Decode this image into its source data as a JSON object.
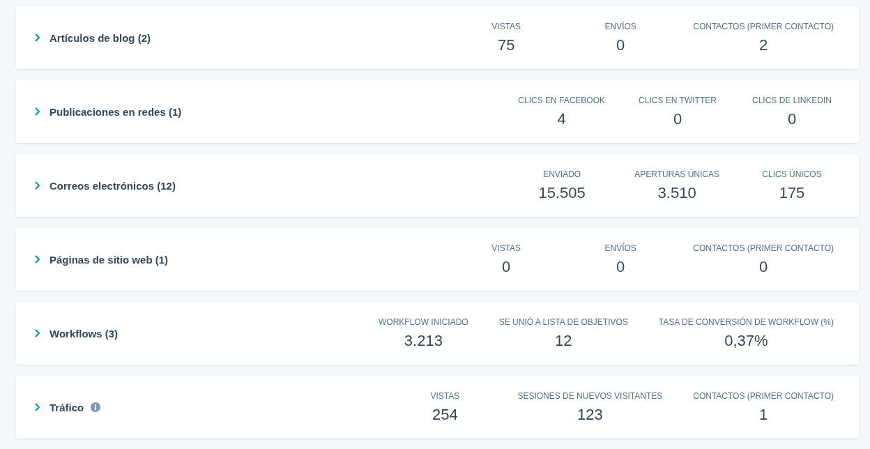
{
  "sections": [
    {
      "title": "Artículos de blog (2)",
      "expanded": false,
      "info": false,
      "metrics": [
        {
          "label": "VISTAS",
          "value": "75"
        },
        {
          "label": "ENVÍOS",
          "value": "0"
        },
        {
          "label": "CONTACTOS (PRIMER CONTACTO)",
          "value": "2"
        }
      ]
    },
    {
      "title": "Publicaciones en redes (1)",
      "expanded": false,
      "info": false,
      "metrics": [
        {
          "label": "CLICS EN FACEBOOK",
          "value": "4"
        },
        {
          "label": "CLICS EN TWITTER",
          "value": "0"
        },
        {
          "label": "CLICS DE LINKEDIN",
          "value": "0"
        }
      ]
    },
    {
      "title": "Correos electrónicos (12)",
      "expanded": false,
      "info": false,
      "metrics": [
        {
          "label": "ENVIADO",
          "value": "15.505"
        },
        {
          "label": "APERTURAS ÚNICAS",
          "value": "3.510"
        },
        {
          "label": "CLICS ÚNICOS",
          "value": "175"
        }
      ]
    },
    {
      "title": "Páginas de sitio web (1)",
      "expanded": false,
      "info": false,
      "metrics": [
        {
          "label": "VISTAS",
          "value": "0"
        },
        {
          "label": "ENVÍOS",
          "value": "0"
        },
        {
          "label": "CONTACTOS (PRIMER CONTACTO)",
          "value": "0"
        }
      ]
    },
    {
      "title": "Workflows (3)",
      "expanded": false,
      "info": false,
      "metrics": [
        {
          "label": "WORKFLOW INICIADO",
          "value": "3.213"
        },
        {
          "label": "SE UNIÓ A LISTA DE OBJETIVOS",
          "value": "12"
        },
        {
          "label": "TASA DE CONVERSIÓN DE WORKFLOW (%)",
          "value": "0,37%"
        }
      ]
    },
    {
      "title": "Tráfico",
      "expanded": false,
      "info": true,
      "metrics": [
        {
          "label": "VISTAS",
          "value": "254"
        },
        {
          "label": "SESIONES DE NUEVOS VISITANTES",
          "value": "123"
        },
        {
          "label": "CONTACTOS (PRIMER CONTACTO)",
          "value": "1"
        }
      ]
    }
  ]
}
